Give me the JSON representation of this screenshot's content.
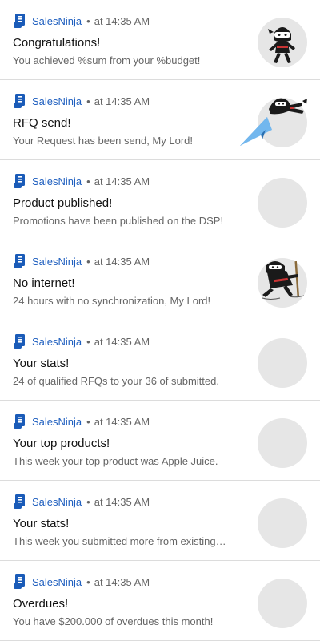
{
  "notifications": [
    {
      "app_name": "SalesNinja",
      "separator": "•",
      "time": "at 14:35 AM",
      "title": "Congratulations!",
      "message": "You achieved %sum from your %budget!",
      "image": "ninja-standing"
    },
    {
      "app_name": "SalesNinja",
      "separator": "•",
      "time": "at 14:35 AM",
      "title": "RFQ send!",
      "message": "Your Request has been send, My Lord!",
      "image": "ninja-paper-plane"
    },
    {
      "app_name": "SalesNinja",
      "separator": "•",
      "time": "at 14:35 AM",
      "title": "Product published!",
      "message": "Promotions have been published on the DSP!",
      "image": "placeholder"
    },
    {
      "app_name": "SalesNinja",
      "separator": "•",
      "time": "at 14:35 AM",
      "title": "No internet!",
      "message": "24 hours with no synchronization, My Lord!",
      "image": "ninja-searching"
    },
    {
      "app_name": "SalesNinja",
      "separator": "•",
      "time": "at 14:35 AM",
      "title": "Your stats!",
      "message": "24 of qualified RFQs to your 36 of submitted.",
      "image": "placeholder"
    },
    {
      "app_name": "SalesNinja",
      "separator": "•",
      "time": "at 14:35 AM",
      "title": "Your top products!",
      "message": "This week your top product was Apple Juice.",
      "image": "placeholder"
    },
    {
      "app_name": "SalesNinja",
      "separator": "•",
      "time": "at 14:35 AM",
      "title": "Your stats!",
      "message": "This week you submitted more from existing…",
      "image": "placeholder"
    },
    {
      "app_name": "SalesNinja",
      "separator": "•",
      "time": "at 14:35 AM",
      "title": "Overdues!",
      "message": "You have $200.000 of overdues this month!",
      "image": "placeholder"
    }
  ],
  "colors": {
    "app_name": "#1f5fbf",
    "icon_blue": "#1a5bb8",
    "meta_gray": "#666666",
    "avatar_bg": "#e6e6e6",
    "divider": "#dcdcdc"
  },
  "icons": {
    "app": "scroll-icon"
  }
}
